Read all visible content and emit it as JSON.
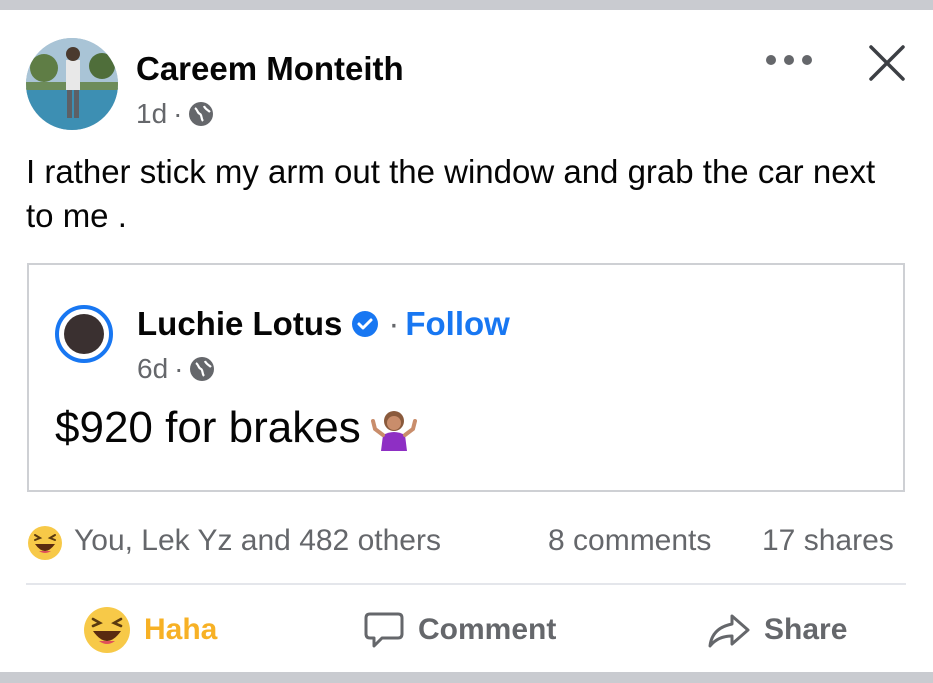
{
  "post": {
    "author": "Careem Monteith",
    "time": "1d",
    "separator": "·",
    "text": "I rather stick my arm out the window and grab the car next to me ."
  },
  "shared": {
    "author": "Luchie Lotus",
    "separator": "·",
    "follow_label": "Follow",
    "time": "6d",
    "text": "$920 for brakes"
  },
  "reactions": {
    "summary": "You, Lek Yz and 482 others",
    "comments": "8 comments",
    "shares": "17 shares"
  },
  "actions": {
    "haha_label": "Haha",
    "comment_label": "Comment",
    "share_label": "Share"
  },
  "icons": {
    "more": "more-options-icon",
    "close": "close-icon",
    "privacy": "globe-icon",
    "verified": "verified-badge-icon",
    "reaction": "haha-emoji-icon",
    "comment": "comment-bubble-icon",
    "share": "share-arrow-icon",
    "emoji_in_text": "shrug-emoji-icon"
  },
  "colors": {
    "link": "#1877f2",
    "haha": "#f7b125",
    "secondary_text": "#65676b"
  }
}
